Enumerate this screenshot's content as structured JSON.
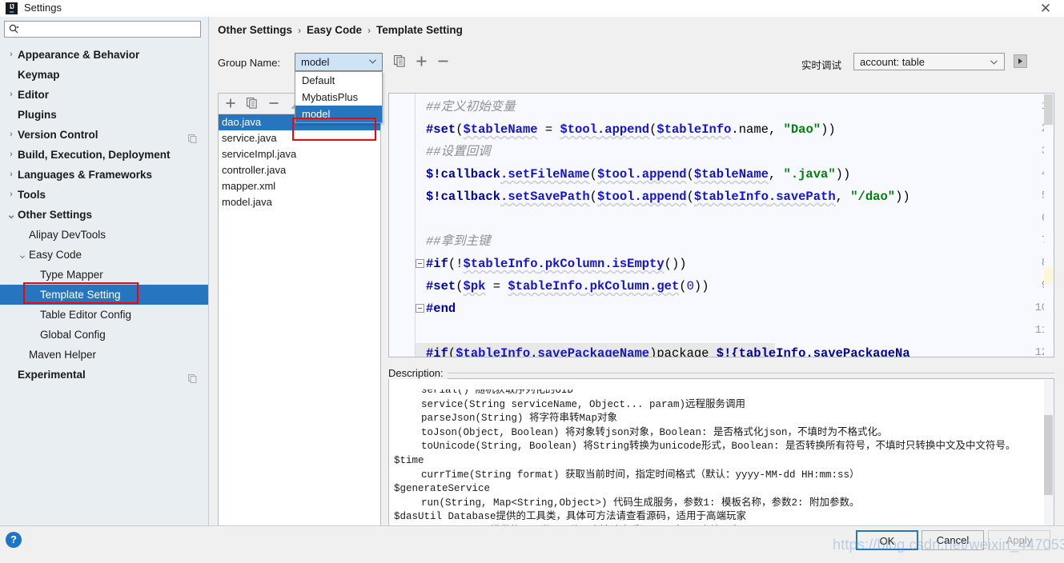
{
  "window": {
    "title": "Settings",
    "icon": "intellij-idea-icon",
    "close_label": "✕"
  },
  "search": {
    "placeholder": "",
    "value": "",
    "icon": "search-icon"
  },
  "sidebar": {
    "items": [
      {
        "label": "Appearance & Behavior",
        "indent": 0,
        "arrow": "collapsed",
        "bold": true,
        "selected": false,
        "copy_icon": false
      },
      {
        "label": "Keymap",
        "indent": 0,
        "arrow": "none",
        "bold": true,
        "selected": false,
        "copy_icon": false
      },
      {
        "label": "Editor",
        "indent": 0,
        "arrow": "collapsed",
        "bold": true,
        "selected": false,
        "copy_icon": false
      },
      {
        "label": "Plugins",
        "indent": 0,
        "arrow": "none",
        "bold": true,
        "selected": false,
        "copy_icon": false
      },
      {
        "label": "Version Control",
        "indent": 0,
        "arrow": "collapsed",
        "bold": true,
        "selected": false,
        "copy_icon": true
      },
      {
        "label": "Build, Execution, Deployment",
        "indent": 0,
        "arrow": "collapsed",
        "bold": true,
        "selected": false,
        "copy_icon": false
      },
      {
        "label": "Languages & Frameworks",
        "indent": 0,
        "arrow": "collapsed",
        "bold": true,
        "selected": false,
        "copy_icon": false
      },
      {
        "label": "Tools",
        "indent": 0,
        "arrow": "collapsed",
        "bold": true,
        "selected": false,
        "copy_icon": false
      },
      {
        "label": "Other Settings",
        "indent": 0,
        "arrow": "expanded",
        "bold": true,
        "selected": false,
        "copy_icon": false
      },
      {
        "label": "Alipay DevTools",
        "indent": 1,
        "arrow": "none",
        "bold": false,
        "selected": false,
        "copy_icon": false
      },
      {
        "label": "Easy Code",
        "indent": 1,
        "arrow": "expanded",
        "bold": false,
        "selected": false,
        "copy_icon": false
      },
      {
        "label": "Type Mapper",
        "indent": 2,
        "arrow": "none",
        "bold": false,
        "selected": false,
        "copy_icon": false
      },
      {
        "label": "Template Setting",
        "indent": 2,
        "arrow": "none",
        "bold": false,
        "selected": true,
        "copy_icon": false
      },
      {
        "label": "Table Editor Config",
        "indent": 2,
        "arrow": "none",
        "bold": false,
        "selected": false,
        "copy_icon": false
      },
      {
        "label": "Global Config",
        "indent": 2,
        "arrow": "none",
        "bold": false,
        "selected": false,
        "copy_icon": false
      },
      {
        "label": "Maven Helper",
        "indent": 1,
        "arrow": "none",
        "bold": false,
        "selected": false,
        "copy_icon": false
      },
      {
        "label": "Experimental",
        "indent": 0,
        "arrow": "none",
        "bold": true,
        "selected": false,
        "copy_icon": true
      }
    ]
  },
  "breadcrumb": {
    "parts": [
      "Other Settings",
      "Easy Code",
      "Template Setting"
    ],
    "separator": "›"
  },
  "group": {
    "label": "Group Name:",
    "selected": "model",
    "options": [
      "Default",
      "MybatisPlus",
      "model"
    ],
    "highlighted_option": "model",
    "copy_button": "copy-group-button",
    "add_button": "+",
    "remove_button": "−"
  },
  "debug": {
    "label": "实时调试",
    "selected": "account: table",
    "run_button": "run-debug-button"
  },
  "file_list": {
    "toolbar": {
      "add": "+",
      "copy": "copy-icon",
      "remove": "−",
      "up": "▲"
    },
    "items": [
      {
        "name": "dao.java",
        "selected": true
      },
      {
        "name": "service.java",
        "selected": false
      },
      {
        "name": "serviceImpl.java",
        "selected": false
      },
      {
        "name": "controller.java",
        "selected": false
      },
      {
        "name": "mapper.xml",
        "selected": false
      },
      {
        "name": "model.java",
        "selected": false
      }
    ]
  },
  "editor": {
    "lines": [
      {
        "num": "1",
        "fold": false,
        "highlight": false,
        "tokens": [
          {
            "t": "##定义初始变量",
            "c": "cmt"
          }
        ]
      },
      {
        "num": "2",
        "fold": false,
        "highlight": false,
        "tokens": [
          {
            "t": "#set",
            "c": "kw"
          },
          {
            "t": "(",
            "c": "plain"
          },
          {
            "t": "$tableName",
            "c": "var"
          },
          {
            "t": " = ",
            "c": "plain"
          },
          {
            "t": "$tool",
            "c": "var"
          },
          {
            "t": ".append",
            "c": "var"
          },
          {
            "t": "(",
            "c": "plain"
          },
          {
            "t": "$tableInfo",
            "c": "var"
          },
          {
            "t": ".name",
            "c": "plain"
          },
          {
            "t": ", ",
            "c": "plain"
          },
          {
            "t": "\"Dao\"",
            "c": "str"
          },
          {
            "t": "))",
            "c": "plain"
          }
        ]
      },
      {
        "num": "3",
        "fold": false,
        "highlight": false,
        "tokens": [
          {
            "t": "##设置回调",
            "c": "cmt"
          }
        ]
      },
      {
        "num": "4",
        "fold": false,
        "highlight": false,
        "tokens": [
          {
            "t": "$!callback",
            "c": "kw"
          },
          {
            "t": ".setFileName",
            "c": "var"
          },
          {
            "t": "(",
            "c": "plain"
          },
          {
            "t": "$tool",
            "c": "var"
          },
          {
            "t": ".append",
            "c": "var"
          },
          {
            "t": "(",
            "c": "plain"
          },
          {
            "t": "$tableName",
            "c": "var"
          },
          {
            "t": ", ",
            "c": "plain"
          },
          {
            "t": "\".java\"",
            "c": "str"
          },
          {
            "t": "))",
            "c": "plain"
          }
        ]
      },
      {
        "num": "5",
        "fold": false,
        "highlight": false,
        "tokens": [
          {
            "t": "$!callback",
            "c": "kw"
          },
          {
            "t": ".setSavePath",
            "c": "var"
          },
          {
            "t": "(",
            "c": "plain"
          },
          {
            "t": "$tool",
            "c": "var"
          },
          {
            "t": ".append",
            "c": "var"
          },
          {
            "t": "(",
            "c": "plain"
          },
          {
            "t": "$tableInfo",
            "c": "var"
          },
          {
            "t": ".savePath",
            "c": "var"
          },
          {
            "t": ", ",
            "c": "plain"
          },
          {
            "t": "\"/dao\"",
            "c": "str"
          },
          {
            "t": "))",
            "c": "plain"
          }
        ]
      },
      {
        "num": "6",
        "fold": false,
        "highlight": false,
        "tokens": []
      },
      {
        "num": "7",
        "fold": false,
        "highlight": false,
        "tokens": [
          {
            "t": "##拿到主键",
            "c": "cmt"
          }
        ]
      },
      {
        "num": "8",
        "fold": true,
        "highlight": false,
        "tokens": [
          {
            "t": "#if",
            "c": "kw"
          },
          {
            "t": "(!",
            "c": "plain"
          },
          {
            "t": "$tableInfo",
            "c": "var"
          },
          {
            "t": ".pkColumn",
            "c": "var"
          },
          {
            "t": ".isEmpty",
            "c": "var"
          },
          {
            "t": "())",
            "c": "plain"
          }
        ]
      },
      {
        "num": "9",
        "fold": false,
        "highlight": false,
        "tokens": [
          {
            "t": "    ",
            "c": "plain"
          },
          {
            "t": "#set",
            "c": "kw"
          },
          {
            "t": "(",
            "c": "plain"
          },
          {
            "t": "$pk",
            "c": "var"
          },
          {
            "t": " = ",
            "c": "plain"
          },
          {
            "t": "$tableInfo",
            "c": "var"
          },
          {
            "t": ".pkColumn",
            "c": "var"
          },
          {
            "t": ".get",
            "c": "var"
          },
          {
            "t": "(",
            "c": "plain"
          },
          {
            "t": "0",
            "c": "num"
          },
          {
            "t": "))",
            "c": "plain"
          }
        ]
      },
      {
        "num": "10",
        "fold": true,
        "highlight": false,
        "tokens": [
          {
            "t": "#end",
            "c": "kw"
          }
        ]
      },
      {
        "num": "11",
        "fold": false,
        "highlight": false,
        "tokens": []
      },
      {
        "num": "12",
        "fold": false,
        "highlight": true,
        "tokens": [
          {
            "t": "#if",
            "c": "kw"
          },
          {
            "t": "(",
            "c": "plain"
          },
          {
            "t": "$tableInfo",
            "c": "var"
          },
          {
            "t": ".savePackageName",
            "c": "var"
          },
          {
            "t": ")",
            "c": "plain"
          },
          {
            "t": "package ",
            "c": "plain"
          },
          {
            "t": "$!{tableInfo",
            "c": "kw"
          },
          {
            "t": ".savePackageNa",
            "c": "kw"
          }
        ]
      }
    ]
  },
  "description": {
    "label": "Description:",
    "lines": [
      {
        "text": "serial() 随机获取序列化的UID",
        "indent": 2,
        "clipped": true
      },
      {
        "text": "service(String serviceName, Object... param)远程服务调用",
        "indent": 2,
        "clipped": false
      },
      {
        "text": "parseJson(String) 将字符串转Map对象",
        "indent": 2,
        "clipped": false
      },
      {
        "text": "toJson(Object, Boolean) 将对象转json对象，Boolean: 是否格式化json，不填时为不格式化。",
        "indent": 2,
        "clipped": false
      },
      {
        "text": "toUnicode(String, Boolean) 将String转换为unicode形式，Boolean: 是否转换所有符号，不填时只转换中文及中文符号。",
        "indent": 2,
        "clipped": false
      },
      {
        "text": "$time",
        "indent": 1,
        "clipped": false
      },
      {
        "text": "currTime(String format) 获取当前时间，指定时间格式（默认：yyyy-MM-dd HH:mm:ss）",
        "indent": 2,
        "clipped": false
      },
      {
        "text": "$generateService",
        "indent": 1,
        "clipped": false
      },
      {
        "text": "run(String, Map<String,Object>) 代码生成服务，参数1: 模板名称，参数2: 附加参数。",
        "indent": 2,
        "clipped": false
      },
      {
        "text": "$dasUtil Database提供的工具类，具体可方法请查看源码，适用于高端玩家",
        "indent": 1,
        "clipped": false
      },
      {
        "text": "$dbUtil  Database提供的工具类，具体可方法请查看源码，适用于高端玩家",
        "indent": 1,
        "clipped": false
      }
    ]
  },
  "footer": {
    "help": "?",
    "ok": "OK",
    "cancel": "Cancel",
    "apply": "Apply"
  },
  "watermark": {
    "text": "https://blog.csdn.net/weixin_44705396"
  },
  "colors": {
    "selection": "#2675bf",
    "highlight_box": "#ff0000",
    "accent": "#1e74c6"
  }
}
